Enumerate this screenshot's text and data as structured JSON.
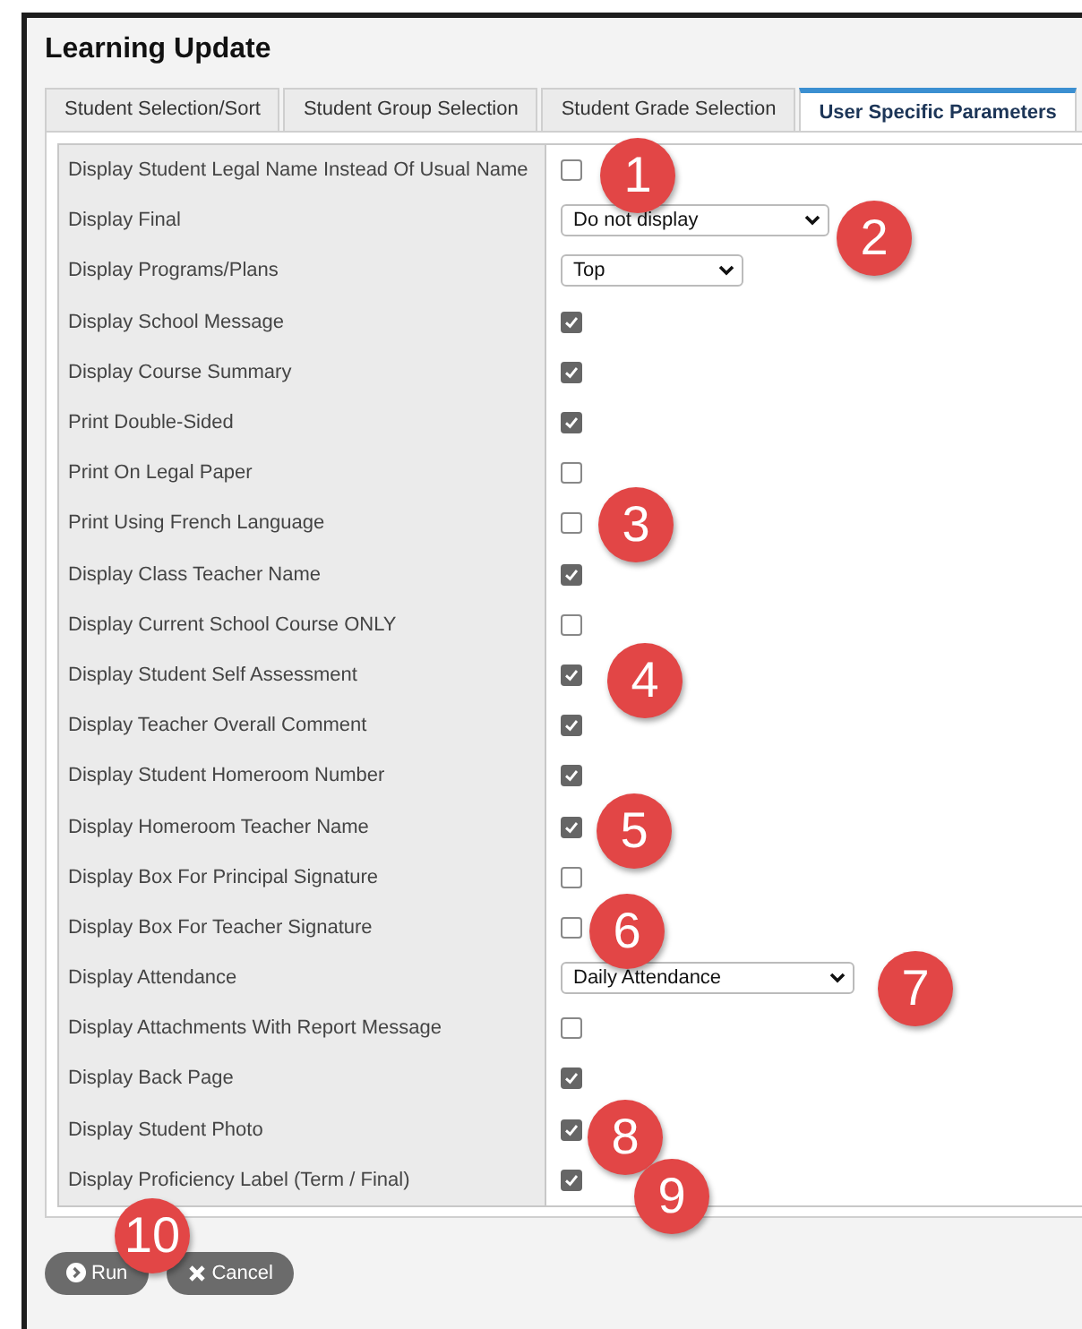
{
  "window": {
    "title": "Learning Update"
  },
  "tabs": [
    {
      "label": "Student Selection/Sort",
      "selected": false
    },
    {
      "label": "Student Group Selection",
      "selected": false
    },
    {
      "label": "Student Grade Selection",
      "selected": false
    },
    {
      "label": "User Specific Parameters",
      "selected": true
    }
  ],
  "parameters": [
    {
      "label": "Display Student Legal Name Instead Of Usual Name",
      "kind": "checkbox",
      "checked": false
    },
    {
      "label": "Display Final",
      "kind": "select",
      "value": "Do not display"
    },
    {
      "label": "Display Programs/Plans",
      "kind": "select",
      "value": "Top"
    },
    {
      "label": "Display School Message",
      "kind": "checkbox",
      "checked": true
    },
    {
      "label": "Display Course Summary",
      "kind": "checkbox",
      "checked": true
    },
    {
      "label": "Print Double-Sided",
      "kind": "checkbox",
      "checked": true
    },
    {
      "label": "Print On Legal Paper",
      "kind": "checkbox",
      "checked": false
    },
    {
      "label": "Print Using French Language",
      "kind": "checkbox",
      "checked": false
    },
    {
      "label": "Display Class Teacher Name",
      "kind": "checkbox",
      "checked": true
    },
    {
      "label": "Display Current School Course ONLY",
      "kind": "checkbox",
      "checked": false
    },
    {
      "label": "Display Student Self Assessment",
      "kind": "checkbox",
      "checked": true
    },
    {
      "label": "Display Teacher Overall Comment",
      "kind": "checkbox",
      "checked": true
    },
    {
      "label": "Display Student Homeroom Number",
      "kind": "checkbox",
      "checked": true
    },
    {
      "label": "Display Homeroom Teacher Name",
      "kind": "checkbox",
      "checked": true
    },
    {
      "label": "Display Box For Principal Signature",
      "kind": "checkbox",
      "checked": false
    },
    {
      "label": "Display Box For Teacher Signature",
      "kind": "checkbox",
      "checked": false
    },
    {
      "label": "Display Attendance",
      "kind": "select",
      "value": "Daily Attendance"
    },
    {
      "label": "Display Attachments With Report Message",
      "kind": "checkbox",
      "checked": false
    },
    {
      "label": "Display Back Page",
      "kind": "checkbox",
      "checked": true
    },
    {
      "label": "Display Student Photo",
      "kind": "checkbox",
      "checked": true
    },
    {
      "label": "Display Proficiency Label (Term / Final)",
      "kind": "checkbox",
      "checked": true
    }
  ],
  "buttons": [
    {
      "label": "Run",
      "kind": "run"
    },
    {
      "label": "Cancel",
      "kind": "cancel"
    }
  ],
  "callouts": [
    "1",
    "2",
    "3",
    "4",
    "5",
    "6",
    "7",
    "8",
    "9",
    "10"
  ]
}
